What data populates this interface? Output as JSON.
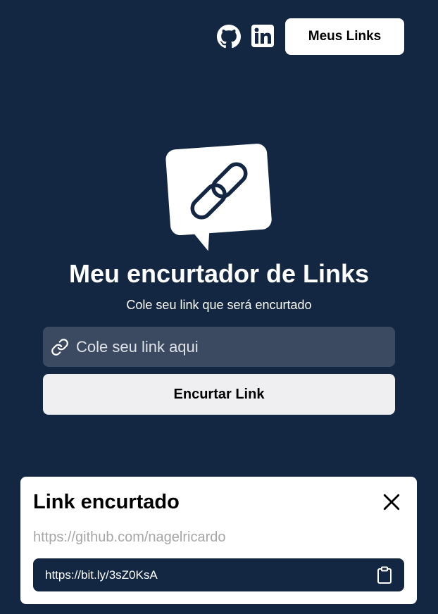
{
  "header": {
    "github_icon": "github-icon",
    "linkedin_icon": "linkedin-icon",
    "meus_links_label": "Meus Links"
  },
  "hero": {
    "logo_icon": "chain-link-speech-bubble-icon",
    "title": "Meu encurtador de Links",
    "subtitle": "Cole seu link que será encurtado"
  },
  "form": {
    "input_icon": "link-icon",
    "input_placeholder": "Cole seu link aqui",
    "input_value": "",
    "submit_label": "Encurtar Link"
  },
  "modal": {
    "title": "Link encurtado",
    "close_icon": "close-icon",
    "original_url": "https://github.com/nagelricardo",
    "short_url": "https://bit.ly/3sZ0KsA",
    "copy_icon": "clipboard-icon"
  },
  "colors": {
    "background": "#132743",
    "input_background": "#3b4a60",
    "button_light": "#efeff1",
    "card": "#ffffff"
  }
}
